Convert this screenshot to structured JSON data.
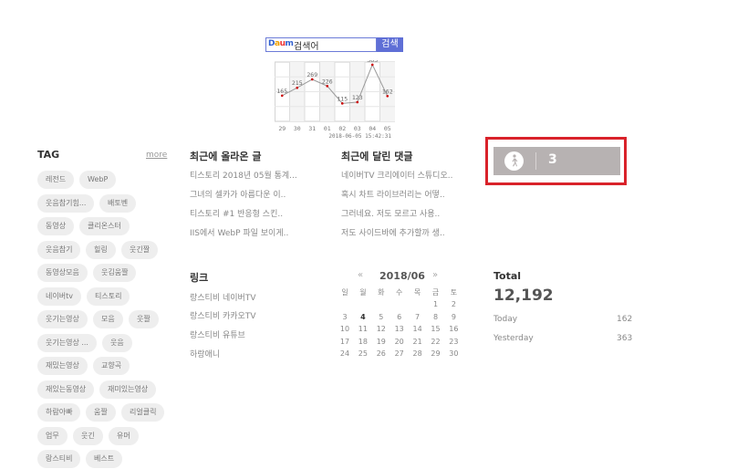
{
  "search": {
    "logo": "Daum",
    "query": "검색어",
    "button": "검색"
  },
  "traffic": {
    "labels": [
      "29",
      "30",
      "31",
      "01",
      "02",
      "03",
      "04",
      "05"
    ],
    "values": [
      165,
      215,
      269,
      226,
      115,
      123,
      363,
      162
    ],
    "max": 380,
    "date": "2018-06-05 15:42:31"
  },
  "tag": {
    "title": "TAG",
    "more": "more",
    "items": [
      "레전드",
      "WebP",
      "웃음참기힘...",
      "배토벤",
      "동영상",
      "클리온스터",
      "웃음참기",
      "힐링",
      "웃긴짤",
      "동영상모음",
      "웃김움짤",
      "네이버tv",
      "티스토리",
      "웃기는영상",
      "모음",
      "웃짤",
      "웃기는영상 ...",
      "웃음",
      "재밌는영상",
      "교향곡",
      "재있는동영상",
      "재미있는영상",
      "하람아빠",
      "움짤",
      "리얼클릭",
      "업무",
      "웃긴",
      "유머",
      "랑스티비",
      "베스트"
    ]
  },
  "recent_posts": {
    "title": "최근에 올라온 글",
    "items": [
      "티스토리 2018년 05월 통계...",
      "그녀의 셀카가 아름다운 이..",
      "티스토리 #1 반응형 스킨..",
      "IIS에서 WebP 파일 보이게.."
    ]
  },
  "recent_comments": {
    "title": "최근에 달린 댓글",
    "items": [
      "네이버TV 크리에이터 스튜디오..",
      "혹시 차트 라이브러리는 어떻..",
      "그러네요. 저도 모르고 사용..",
      "저도 사이드바에 추가할까 생.."
    ]
  },
  "visitor_badge": {
    "count": "3",
    "icon": "walking-person-icon"
  },
  "links": {
    "title": "링크",
    "items": [
      "랑스티비 네이버TV",
      "랑스티비 카카오TV",
      "랑스티비 유튜브",
      "하랑애니"
    ]
  },
  "calendar": {
    "prev": "«",
    "next": "»",
    "month": "2018/06",
    "weekdays": [
      "일",
      "월",
      "화",
      "수",
      "목",
      "금",
      "토"
    ],
    "weeks": [
      [
        "",
        "",
        "",
        "",
        "",
        "1",
        "2"
      ],
      [
        "3",
        "4",
        "5",
        "6",
        "7",
        "8",
        "9"
      ],
      [
        "10",
        "11",
        "12",
        "13",
        "14",
        "15",
        "16"
      ],
      [
        "17",
        "18",
        "19",
        "20",
        "21",
        "22",
        "23"
      ],
      [
        "24",
        "25",
        "26",
        "27",
        "28",
        "29",
        "30"
      ]
    ],
    "today": "4"
  },
  "counter": {
    "total_label": "Total",
    "total": "12,192",
    "today_label": "Today",
    "today": "162",
    "yesterday_label": "Yesterday",
    "yesterday": "363"
  },
  "colors": {
    "badge_outline": "#d9222a",
    "badge_bg": "#b7b2b2",
    "chart_line": "#999999",
    "chart_point": "#cc0000"
  }
}
